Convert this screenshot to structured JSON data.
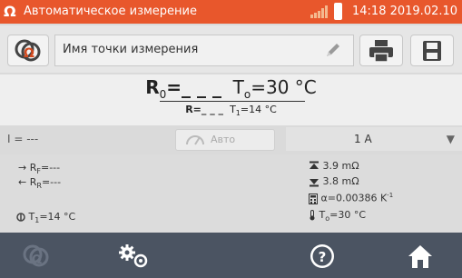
{
  "titlebar": {
    "logo": "Ω",
    "title": "Автоматическое измерение",
    "datetime": "14:18 2019.02.10"
  },
  "toolbar": {
    "measure_point_label": "Имя точки измерения"
  },
  "measurement": {
    "r0_label": "R",
    "r0_sub": "0",
    "r0_value": "=_ _ _",
    "t0_label": "T",
    "t0_sub": "o",
    "t0_value": "=30 °C",
    "r_label": "R",
    "r_value": "=_ _ _",
    "t1_label": "T",
    "t1_sub": "1",
    "t1_value": "=14 °C"
  },
  "controls": {
    "current": "I = ---",
    "auto_label": "Авто",
    "range_value": "1 A",
    "range_arrow": "▼"
  },
  "info": {
    "rf": "R",
    "rf_sub": "F",
    "rf_value": "=---",
    "rr": "R",
    "rr_sub": "R",
    "rr_value": "=---",
    "t1": "T",
    "t1_sub": "1",
    "t1_value": "=14 °C",
    "upper_limit": "3.9 mΩ",
    "lower_limit": "3.8 mΩ",
    "alpha": "α=0.00386 K",
    "alpha_exp": "-1",
    "t0": "T",
    "t0_sub": "o",
    "t0_value": "=30 °C"
  },
  "colors": {
    "titlebar": "#e8572c",
    "bottombar": "#4b5462"
  }
}
